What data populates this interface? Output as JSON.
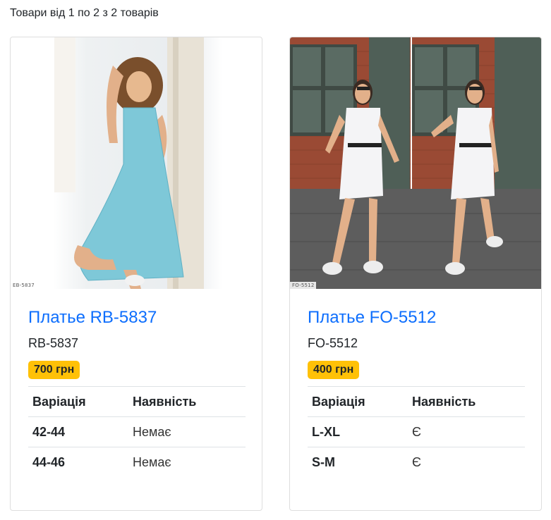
{
  "listing": {
    "results_count": "Товари від 1 по 2 з 2 товарів"
  },
  "products": [
    {
      "image_alt": "Платье RB-5837 photo",
      "image_tag": "EB-5837",
      "title": "Платье RB-5837",
      "code": "RB-5837",
      "price": "700 грн",
      "table_headers": {
        "variation": "Варіація",
        "availability": "Наявність"
      },
      "variants": [
        {
          "size": "42-44",
          "availability": "Немає"
        },
        {
          "size": "44-46",
          "availability": "Немає"
        }
      ]
    },
    {
      "image_alt": "Платье FO-5512 photo",
      "image_tag": "FO-5512",
      "title": "Платье FO-5512",
      "code": "FO-5512",
      "price": "400 грн",
      "table_headers": {
        "variation": "Варіація",
        "availability": "Наявність"
      },
      "variants": [
        {
          "size": "L-XL",
          "availability": "Є"
        },
        {
          "size": "S-M",
          "availability": "Є"
        }
      ]
    }
  ],
  "colors": {
    "link": "#0d6efd",
    "price_badge": "#ffc107",
    "dress_blue": "#7ec8d8",
    "dress_white": "#f4f4f6",
    "brick": "#9a4a34"
  }
}
